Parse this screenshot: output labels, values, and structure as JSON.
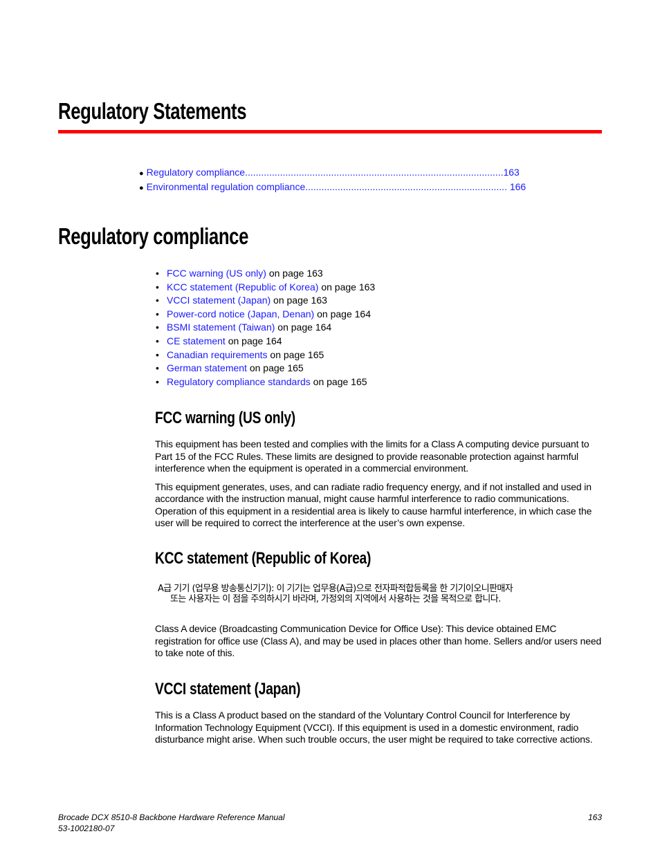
{
  "chapter": {
    "title": "Regulatory Statements",
    "accent_color": "#ff0000",
    "toc": [
      {
        "label": "Regulatory compliance",
        "leader": "................................................................................................",
        "page": "163"
      },
      {
        "label": "Environmental regulation compliance",
        "leader": "........................................................................... ",
        "page": "166"
      }
    ]
  },
  "section": {
    "title": "Regulatory compliance",
    "links": [
      {
        "label": "FCC warning (US only)",
        "suffix": " on page 163"
      },
      {
        "label": "KCC statement (Republic of Korea)",
        "suffix": " on page 163"
      },
      {
        "label": "VCCI statement (Japan)",
        "suffix": " on page 163"
      },
      {
        "label": "Power-cord notice (Japan, Denan)",
        "suffix": " on page 164"
      },
      {
        "label": "BSMI statement (Taiwan)",
        "suffix": " on page 164"
      },
      {
        "label": "CE statement",
        "suffix": " on page 164"
      },
      {
        "label": "Canadian requirements",
        "suffix": " on page 165"
      },
      {
        "label": "German statement",
        "suffix": " on page 165"
      },
      {
        "label": "Regulatory compliance standards",
        "suffix": " on page 165"
      }
    ],
    "bullet": "•"
  },
  "fcc": {
    "title": "FCC warning (US only)",
    "p1": "This equipment has been tested and complies with the limits for a Class A computing device pursuant to Part 15 of the FCC Rules. These limits are designed to provide reasonable protection against harmful interference when the equipment is operated in a commercial environment.",
    "p2": "This equipment generates, uses, and can radiate radio frequency energy, and if not installed and used in accordance with the instruction manual, might cause harmful interference to radio communications. Operation of this equipment in a residential area is likely to cause harmful interference, in which case the user will be required to correct the interference at the user’s own expense."
  },
  "kcc": {
    "title": "KCC statement (Republic of Korea)",
    "korean_line1": "A급 기기 (업무용 방송통신기기): 이 기기는 업무용(A급)으로 전자파적합등록을 한 기기이오니판매자",
    "korean_line2": "또는 사용자는 이 점을 주의하시기 바라며, 가정외의 지역에서 사용하는 것을 목적으로 합니다.",
    "p1": "Class A device (Broadcasting Communication Device for Office Use): This device obtained EMC registration for office use (Class A), and may be used in places other than home.  Sellers and/or users need to take note of this."
  },
  "vcci": {
    "title": "VCCI statement (Japan)",
    "p1": "This is a Class A product based on the standard of the Voluntary Control Council for Interference by Information Technology Equipment (VCCI). If this equipment is used in a domestic environment, radio disturbance might arise. When such trouble occurs, the user might be required to take corrective actions."
  },
  "footer": {
    "manual_title": "Brocade DCX 8510-8 Backbone Hardware Reference Manual",
    "doc_number": "53-1002180-07",
    "page_number": "163"
  }
}
